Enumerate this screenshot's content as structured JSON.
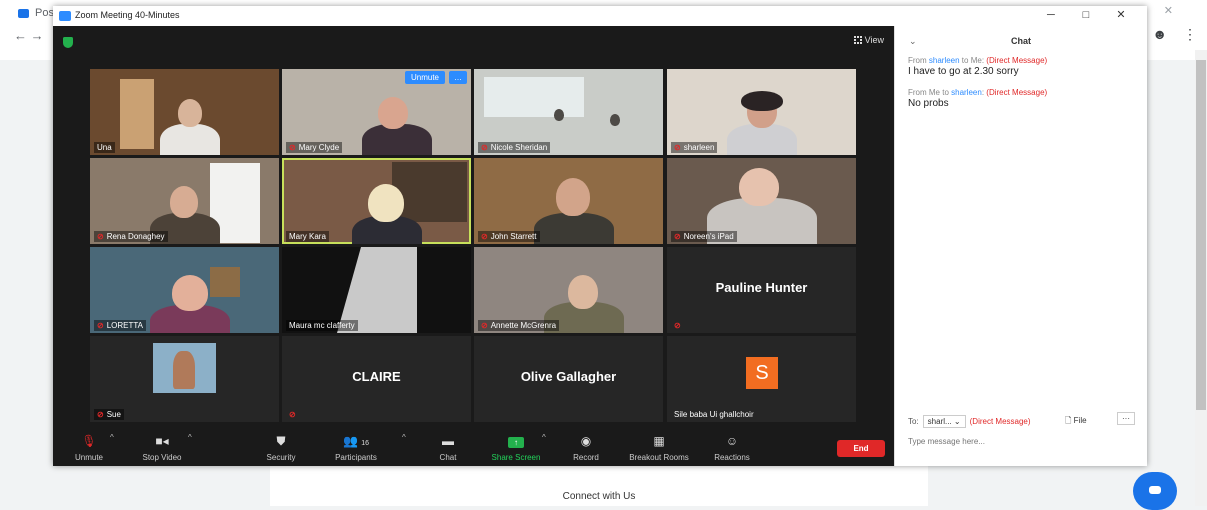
{
  "browser": {
    "tab_label": "Pos",
    "nav_glyphs": "← →",
    "account_glyph": "☻",
    "menu_glyph": "⋮",
    "window_controls": "─ □ ✕"
  },
  "page": {
    "connect_text": "Connect with Us"
  },
  "zoom": {
    "window_title": "Zoom Meeting 40-Minutes",
    "view_label": "View",
    "window_controls": [
      "─",
      "□",
      "✕"
    ],
    "tiles": [
      {
        "name": "Una",
        "muted": false
      },
      {
        "name": "Mary Clyde",
        "muted": true
      },
      {
        "name": "Nicole Sheridan",
        "muted": true
      },
      {
        "name": "sharleen",
        "muted": true
      },
      {
        "name": "Rena Donaghey",
        "muted": true
      },
      {
        "name": "Mary Kara",
        "muted": false
      },
      {
        "name": "John Starrett",
        "muted": true
      },
      {
        "name": "Noreen's iPad",
        "muted": true
      },
      {
        "name": "LORETTA",
        "muted": true
      },
      {
        "name": "Maura mc clafferty",
        "muted": false
      },
      {
        "name": "Annette McGrenra",
        "muted": true
      },
      {
        "name": "Pauline Hunter",
        "muted": true
      },
      {
        "name": "Sue",
        "muted": true
      },
      {
        "name": "CLAIRE",
        "muted": true
      },
      {
        "name": "Olive Gallagher",
        "muted": false
      },
      {
        "name": "Sile baba Ui ghallchoir",
        "muted": false
      }
    ],
    "unmute_pill": "Unmute",
    "more_pill": "…",
    "avatar_letter": "S",
    "toolbar": {
      "unmute": "Unmute",
      "stop_video": "Stop Video",
      "security": "Security",
      "participants": "Participants",
      "participants_count": "16",
      "chat": "Chat",
      "share_screen": "Share Screen",
      "record": "Record",
      "breakout_rooms": "Breakout Rooms",
      "reactions": "Reactions",
      "end": "End"
    },
    "accent_color": "#2d8cff",
    "end_color": "#e02828",
    "share_color": "#23d35b"
  },
  "chat": {
    "title": "Chat",
    "messages": [
      {
        "from": "sharleen",
        "to": "Me",
        "dm": "(Direct Message)",
        "text": "I have to go at 2.30 sorry"
      },
      {
        "from": "Me",
        "to": "sharleen",
        "dm": "(Direct Message)",
        "text": "No probs"
      }
    ],
    "to_label": "To:",
    "to_value": "sharl...",
    "to_dm": "(Direct Message)",
    "file_label": "File",
    "more_label": "···",
    "input_placeholder": "Type message here..."
  }
}
